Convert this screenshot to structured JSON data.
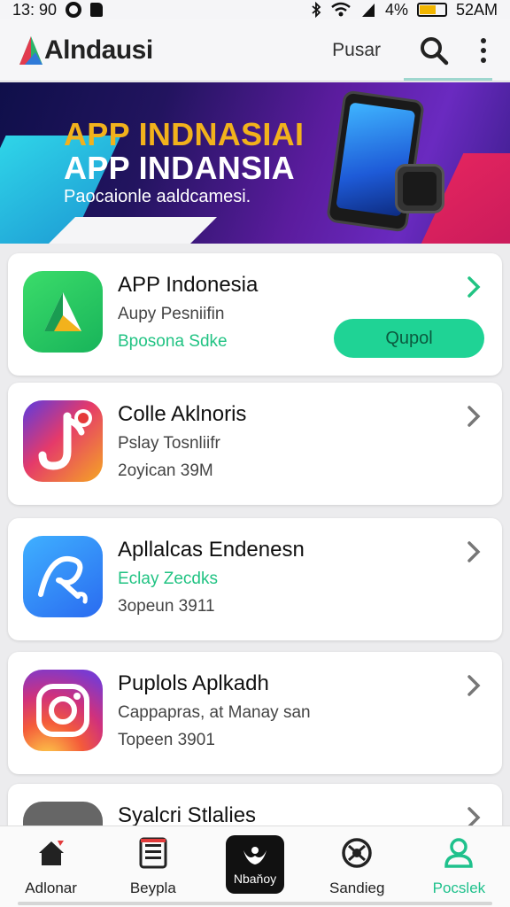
{
  "status_bar": {
    "time": "13: 90",
    "battery_percent": "4%",
    "clock_right": "52AM"
  },
  "app_bar": {
    "logo_text": "Alndausi",
    "menu_label": "Pusar"
  },
  "banner": {
    "title_line1": "APP INDNASIAI",
    "title_line2": "APP INDANSIA",
    "subtitle": "Paocaionle aaldcamesi."
  },
  "apps": [
    {
      "name": "APP Indonesia",
      "line2": "Aupy Pesniifin",
      "line3": "Bposona Sdke",
      "action": "Qupol"
    },
    {
      "name": "Colle Aklnoris",
      "line2": "Pslay Tosnliifr",
      "line3": "2oyican 39M"
    },
    {
      "name": "Apllalcas Endenesn",
      "line2": "Eclay Zecdks",
      "line3": "3opeun 3911"
    },
    {
      "name": "Puplols Aplkadh",
      "line2": "Cappapras, at Manay san",
      "line3": "Topeen 3901"
    },
    {
      "name": "Syalcri Stlalies"
    }
  ],
  "bottom_nav": {
    "items": [
      {
        "label": "Adlonar",
        "icon": "home-icon"
      },
      {
        "label": "Beypla",
        "icon": "list-icon"
      },
      {
        "label": "Nbaňoy",
        "icon": "bird-icon"
      },
      {
        "label": "Sandieg",
        "icon": "globe-icon"
      },
      {
        "label": "Pocslek",
        "icon": "profile-icon"
      }
    ]
  },
  "colors": {
    "accent_green": "#1fd395",
    "banner_yellow": "#f2b21c"
  }
}
